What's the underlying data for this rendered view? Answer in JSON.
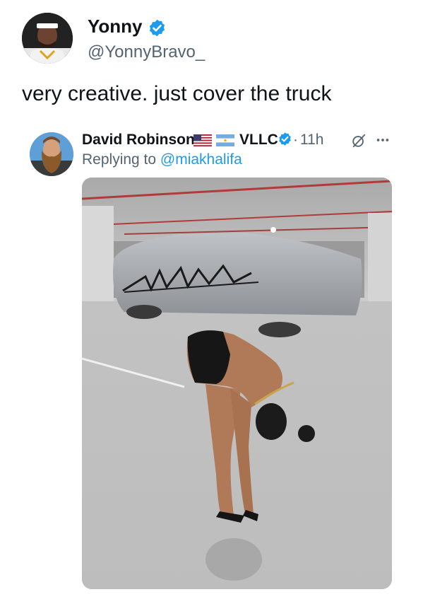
{
  "tweet": {
    "display_name": "Yonny",
    "handle": "@YonnyBravo_",
    "text": "very creative. just cover the truck"
  },
  "quoted_tweet": {
    "display_name": "David Robinson",
    "affiliation": "VLLC",
    "separator": "·",
    "time": "11h",
    "reply_prefix": "Replying to",
    "reply_mention": "@miakhalifa"
  },
  "icons": {
    "verified": "verified-badge-icon",
    "flag_us": "us-flag-icon",
    "flag_ar": "argentina-flag-icon",
    "grok": "grok-icon",
    "more": "more-options-icon"
  },
  "colors": {
    "verified": "#1d9bf0",
    "link": "#1d9bf0",
    "secondary_text": "#536471",
    "primary_text": "#0f1419"
  }
}
